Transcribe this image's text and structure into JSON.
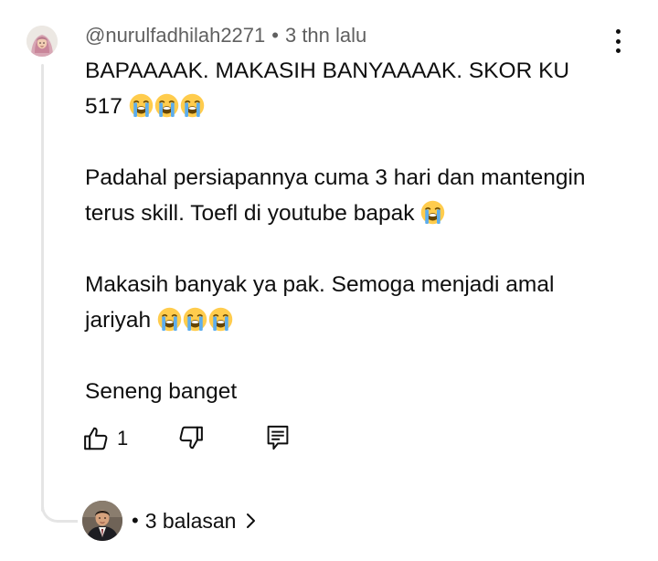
{
  "comment": {
    "author": "@nurulfadhilah2271",
    "separator": "•",
    "time": "3 thn lalu",
    "paragraphs": [
      {
        "lines": [
          {
            "text": "BAPAAAAK. MAKASIH BANYAAAAK. SKOR KU"
          },
          {
            "text": "517 ",
            "emoji_count": 3
          }
        ]
      },
      {
        "lines": [
          {
            "text": "Padahal persiapannya cuma 3 hari dan mantengin"
          },
          {
            "text": "terus skill. Toefl di youtube bapak ",
            "emoji_count": 1
          }
        ]
      },
      {
        "lines": [
          {
            "text": "Makasih banyak ya pak. Semoga menjadi amal"
          },
          {
            "text": "jariyah ",
            "emoji_count": 3
          }
        ]
      },
      {
        "lines": [
          {
            "text": "Seneng banget"
          }
        ]
      }
    ],
    "emoji_icon": "loudly-crying-face-icon",
    "likes": "1"
  },
  "replies": {
    "separator": "•",
    "label": "3 balasan"
  },
  "colors": {
    "text": "#0f0f0f",
    "secondary_text": "#606060",
    "thread_line": "#e5e5e5",
    "emoji_face": "#FFCC4D",
    "emoji_tears": "#5DADEC"
  }
}
